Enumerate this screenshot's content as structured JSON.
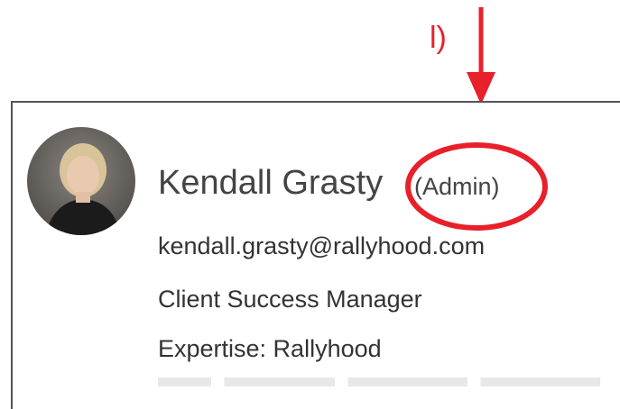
{
  "annotation": {
    "label": "l)",
    "color": "#e8202a"
  },
  "profile": {
    "name": "Kendall Grasty",
    "role": "(Admin)",
    "email": "kendall.grasty@rallyhood.com",
    "job_title": "Client Success Manager",
    "expertise": "Expertise: Rallyhood",
    "avatar_icon": "user-photo"
  },
  "colors": {
    "text": "#444444",
    "annotation_red": "#e8202a",
    "border": "#555555"
  }
}
